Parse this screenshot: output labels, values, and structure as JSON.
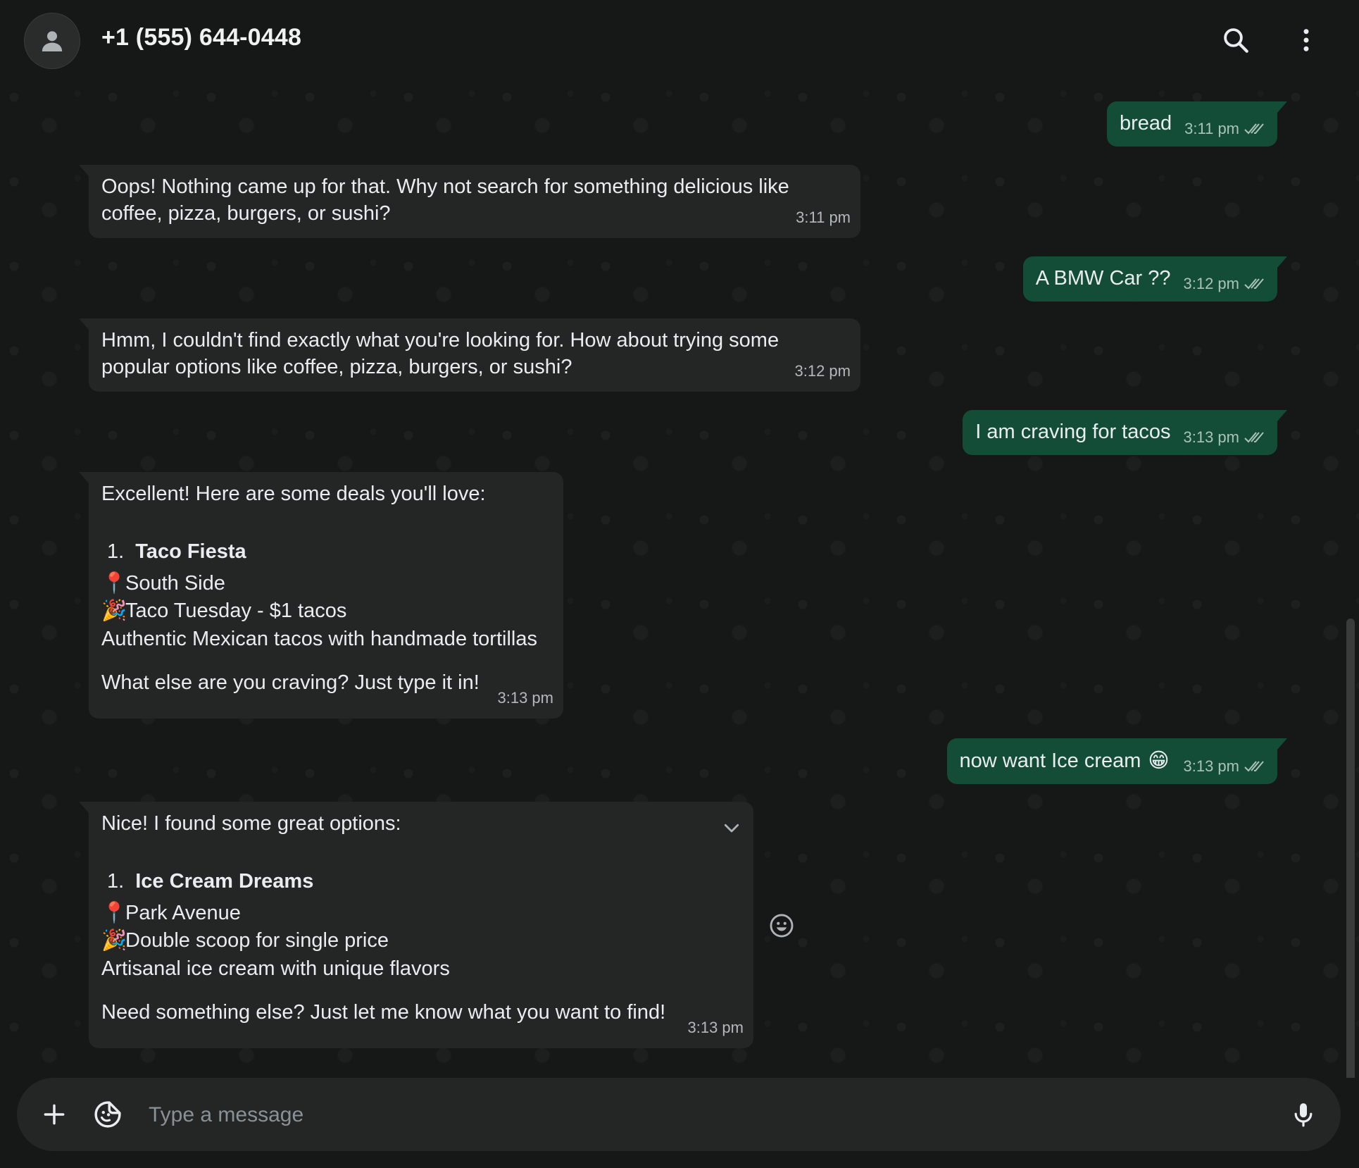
{
  "header": {
    "contact_name": "+1 (555) 644-0448"
  },
  "messages": [
    {
      "dir": "out",
      "text": "bread",
      "time": "3:11 pm"
    },
    {
      "dir": "in",
      "lines": [
        "Oops! Nothing came up for that. Why not search for something delicious like",
        "coffee, pizza, burgers, or sushi?"
      ],
      "time": "3:11 pm"
    },
    {
      "dir": "out",
      "text": "A BMW Car ??",
      "time": "3:12 pm"
    },
    {
      "dir": "in",
      "lines": [
        "Hmm, I couldn't find exactly what you're looking for. How about trying some",
        "popular options like coffee, pizza, burgers, or sushi?"
      ],
      "time": "3:12 pm"
    },
    {
      "dir": "out",
      "text": "I am craving for tacos",
      "time": "3:13 pm"
    },
    {
      "dir": "in",
      "intro": "Excellent! Here are some deals you'll love:",
      "item_number": "1.",
      "item_name": "Taco Fiesta",
      "location": "South Side",
      "deal": "Taco Tuesday - $1 tacos",
      "description": "Authentic Mexican tacos with handmade tortillas",
      "closing": "What else are you craving? Just type it in!",
      "time": "3:13 pm"
    },
    {
      "dir": "out",
      "text": "now want Ice cream",
      "emoji": "😁",
      "time": "3:13 pm"
    },
    {
      "dir": "in",
      "intro": "Nice! I found some great options:",
      "item_number": "1.",
      "item_name": "Ice Cream Dreams",
      "location": "Park Avenue",
      "deal": "Double scoop for single price",
      "description": "Artisanal ice cream with unique flavors",
      "closing": "Need something else? Just let me know what you want to find!",
      "time": "3:13 pm"
    }
  ],
  "icons": {
    "pin": "📍",
    "party": "🎉",
    "read_receipt": "double-check-icon"
  },
  "composer": {
    "placeholder": "Type a message"
  },
  "colors": {
    "background": "#161717",
    "incoming_bubble": "#242626",
    "outgoing_bubble": "#144d37",
    "accent": "#25d366"
  }
}
